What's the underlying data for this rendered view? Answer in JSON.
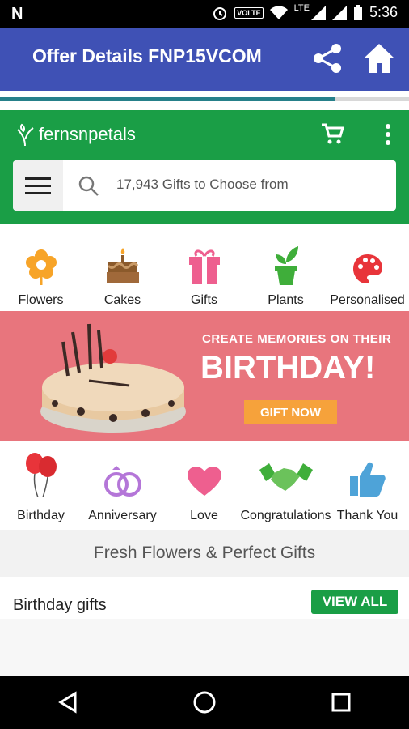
{
  "status_bar": {
    "carrier_icon": "N",
    "volte": "VOLTE",
    "lte": "LTE",
    "time": "5:36"
  },
  "app_bar": {
    "title": "Offer Details FNP15VCOM"
  },
  "page_load_progress": 0.82,
  "brand": {
    "logo_text": "fernsnpetals"
  },
  "search": {
    "placeholder": "17,943 Gifts to Choose from"
  },
  "categories": [
    {
      "label": "Flowers",
      "icon": "flower-icon"
    },
    {
      "label": "Cakes",
      "icon": "cake-icon"
    },
    {
      "label": "Gifts",
      "icon": "gift-icon"
    },
    {
      "label": "Plants",
      "icon": "plant-icon"
    },
    {
      "label": "Personalised",
      "icon": "palette-icon"
    }
  ],
  "banner": {
    "subtitle": "CREATE MEMORIES ON THEIR",
    "headline": "BIRTHDAY!",
    "cta": "GIFT NOW"
  },
  "occasions": [
    {
      "label": "Birthday",
      "icon": "balloons-icon"
    },
    {
      "label": "Anniversary",
      "icon": "rings-icon"
    },
    {
      "label": "Love",
      "icon": "heart-icon"
    },
    {
      "label": "Congratulations",
      "icon": "handshake-icon"
    },
    {
      "label": "Thank You",
      "icon": "thumbs-up-icon"
    }
  ],
  "tagline": "Fresh Flowers & Perfect Gifts",
  "section": {
    "title": "Birthday gifts",
    "view_all": "VIEW ALL"
  },
  "colors": {
    "app_bar": "#3f51b5",
    "brand_green": "#1a9e46",
    "banner_pink": "#e8757d",
    "cta_orange": "#f6a23b"
  }
}
